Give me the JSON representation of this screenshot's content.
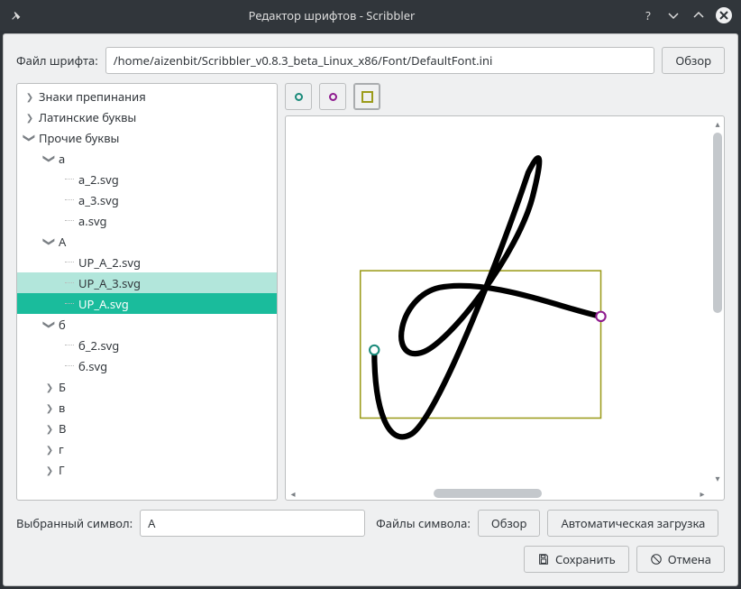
{
  "titlebar": {
    "title": "Редактор шрифтов - Scribbler"
  },
  "file_row": {
    "label": "Файл шрифта:",
    "path": "/home/aizenbit/Scribbler_v0.8.3_beta_Linux_x86/Font/DefaultFont.ini",
    "browse": "Обзор"
  },
  "tree": {
    "items": [
      {
        "label": "Знаки препинания",
        "depth": 0,
        "arrow": "r"
      },
      {
        "label": "Латинские буквы",
        "depth": 0,
        "arrow": "r"
      },
      {
        "label": "Прочие буквы",
        "depth": 0,
        "arrow": "d"
      },
      {
        "label": "а",
        "depth": 1,
        "arrow": "d"
      },
      {
        "label": "а_2.svg",
        "depth": 2,
        "arrow": ""
      },
      {
        "label": "а_3.svg",
        "depth": 2,
        "arrow": ""
      },
      {
        "label": "а.svg",
        "depth": 2,
        "arrow": ""
      },
      {
        "label": "А",
        "depth": 1,
        "arrow": "d"
      },
      {
        "label": "UP_А_2.svg",
        "depth": 2,
        "arrow": ""
      },
      {
        "label": "UP_А_3.svg",
        "depth": 2,
        "arrow": "",
        "hover": true
      },
      {
        "label": "UP_А.svg",
        "depth": 2,
        "arrow": "",
        "selected": true
      },
      {
        "label": "б",
        "depth": 1,
        "arrow": "d"
      },
      {
        "label": "б_2.svg",
        "depth": 2,
        "arrow": ""
      },
      {
        "label": "б.svg",
        "depth": 2,
        "arrow": ""
      },
      {
        "label": "Б",
        "depth": 1,
        "arrow": "r"
      },
      {
        "label": "в",
        "depth": 1,
        "arrow": "r"
      },
      {
        "label": "В",
        "depth": 1,
        "arrow": "r"
      },
      {
        "label": "г",
        "depth": 1,
        "arrow": "r"
      },
      {
        "label": "Г",
        "depth": 1,
        "arrow": "r"
      }
    ]
  },
  "colors": {
    "teal": "#1a8a7a",
    "purple": "#8e1a8e",
    "olive": "#9b9b1a"
  },
  "symbol_row": {
    "label": "Выбранный символ:",
    "value": "А",
    "files_label": "Файлы символа:",
    "browse": "Обзор",
    "autoload": "Автоматическая загрузка"
  },
  "action_row": {
    "save": "Сохранить",
    "cancel": "Отмена"
  }
}
